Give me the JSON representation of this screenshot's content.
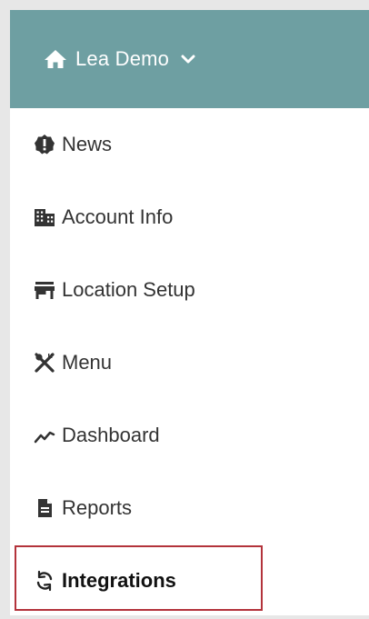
{
  "header": {
    "title": "Lea Demo",
    "background_color": "#6e9fa2",
    "home_icon": "home-icon",
    "dropdown_icon": "chevron-down-icon"
  },
  "nav": {
    "items": [
      {
        "label": "News",
        "icon": "badge-alert-icon"
      },
      {
        "label": "Account Info",
        "icon": "building-icon"
      },
      {
        "label": "Location Setup",
        "icon": "storefront-icon"
      },
      {
        "label": "Menu",
        "icon": "utensils-cross-icon"
      },
      {
        "label": "Dashboard",
        "icon": "line-trend-icon"
      },
      {
        "label": "Reports",
        "icon": "document-icon"
      },
      {
        "label": "Integrations",
        "icon": "sync-icon",
        "selected": true
      }
    ],
    "highlight_color": "#b3333b"
  }
}
